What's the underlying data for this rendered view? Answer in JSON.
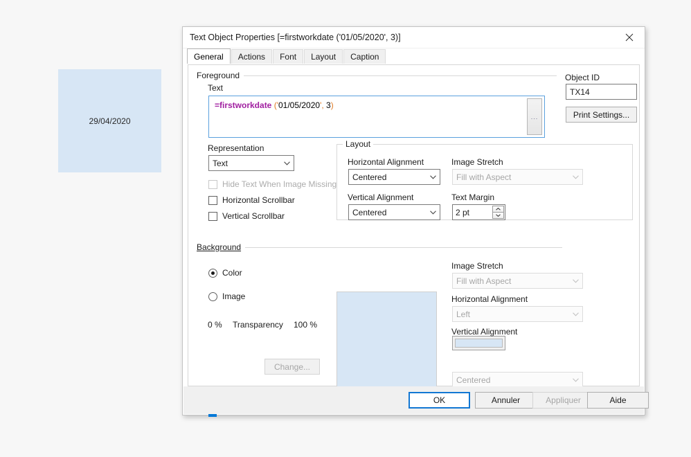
{
  "canvas": {
    "object_text": "29/04/2020",
    "object_color": "#d7e6f5"
  },
  "dialog": {
    "title": "Text Object Properties [=firstworkdate ('01/05/2020', 3)]",
    "close_icon": "close-icon",
    "tabs": [
      {
        "label": "General",
        "active": true
      },
      {
        "label": "Actions",
        "active": false
      },
      {
        "label": "Font",
        "active": false
      },
      {
        "label": "Layout",
        "active": false
      },
      {
        "label": "Caption",
        "active": false
      }
    ]
  },
  "foreground": {
    "group_label": "Foreground",
    "text_label": "Text",
    "formula": {
      "function": "=firstworkdate",
      "open_paren": "(",
      "quote_open": "'",
      "date": "01/05/2020",
      "quote_close": "'",
      "comma": ",",
      "arg2": " 3",
      "close_paren": ")",
      "full": "=firstworkdate ('01/05/2020', 3)"
    },
    "ellipsis_button": "...",
    "representation_label": "Representation",
    "representation_value": "Text",
    "hide_text_label": "Hide Text When Image Missing",
    "horizontal_scrollbar_label": "Horizontal Scrollbar",
    "vertical_scrollbar_label": "Vertical Scrollbar"
  },
  "object": {
    "id_label": "Object ID",
    "id_value": "TX14",
    "print_settings_label": "Print Settings..."
  },
  "layout": {
    "group_label": "Layout",
    "horizontal_alignment_label": "Horizontal Alignment",
    "horizontal_alignment_value": "Centered",
    "vertical_alignment_label": "Vertical Alignment",
    "vertical_alignment_value": "Centered",
    "image_stretch_label": "Image Stretch",
    "image_stretch_value": "Fill with Aspect",
    "text_margin_label": "Text Margin",
    "text_margin_value": "2 pt"
  },
  "background": {
    "group_label": "Background",
    "color_label": "Color",
    "image_label": "Image",
    "change_label": "Change...",
    "transparency_label": "Transparency",
    "transparency_min": "0 %",
    "transparency_max": "100 %",
    "transparency_value": 0,
    "swatch_color": "#d7e6f5",
    "preview_color": "#d7e6f5",
    "image_stretch_label": "Image Stretch",
    "image_stretch_value": "Fill with Aspect",
    "horizontal_alignment_label": "Horizontal Alignment",
    "horizontal_alignment_value": "Left",
    "vertical_alignment_label": "Vertical Alignment",
    "vertical_alignment_value": "Centered"
  },
  "buttons": {
    "ok": "OK",
    "cancel": "Annuler",
    "apply": "Appliquer",
    "help": "Aide"
  }
}
